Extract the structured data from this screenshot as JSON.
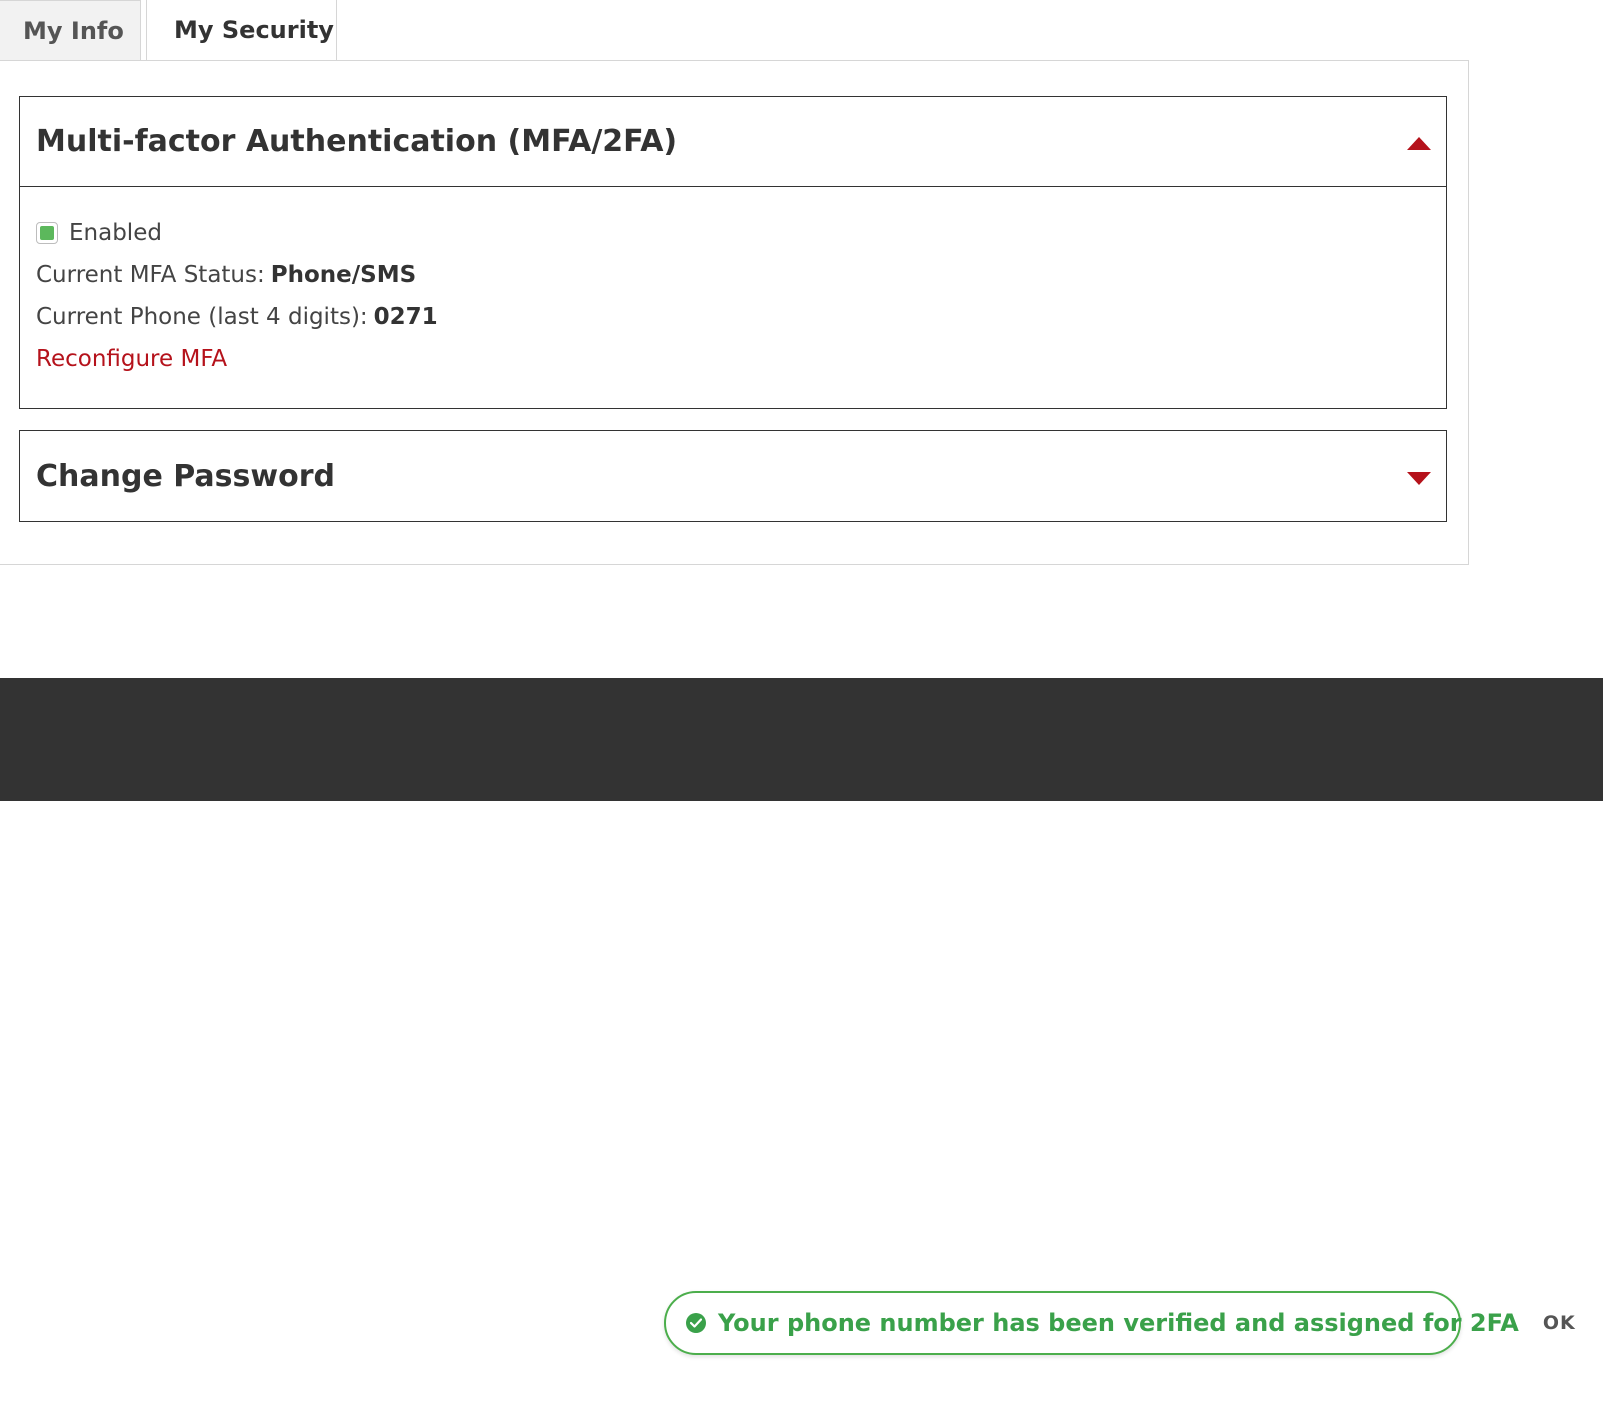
{
  "tabs": [
    {
      "label": "My Info",
      "active": false
    },
    {
      "label": "My Security",
      "active": true
    }
  ],
  "mfa_section": {
    "title": "Multi-factor Authentication (MFA/2FA)",
    "expanded": true,
    "enabled_label": "Enabled",
    "enabled_checked": true,
    "status_label": "Current MFA Status:",
    "status_value": "Phone/SMS",
    "phone_label": "Current Phone (last 4 digits):",
    "phone_value": "0271",
    "reconfigure_link": "Reconfigure MFA"
  },
  "password_section": {
    "title": "Change Password",
    "expanded": false
  },
  "toast": {
    "message": "Your phone number has been verified and assigned for 2FA",
    "ok_label": "OK",
    "icon": "check-circle-icon"
  },
  "colors": {
    "accent_red": "#b5121b",
    "success_green": "#3aa14a",
    "checkbox_green": "#5cb85c",
    "footer_band": "#333333"
  }
}
